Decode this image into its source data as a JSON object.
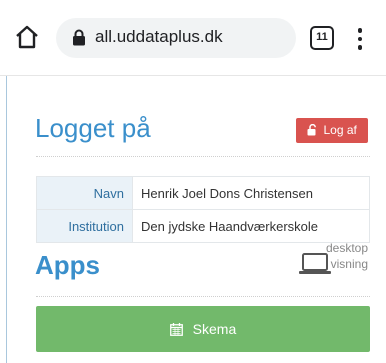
{
  "browser": {
    "url": "all.uddataplus.dk",
    "tab_count": "11"
  },
  "header": {
    "title": "Logget på",
    "logout_label": "Log af"
  },
  "info": {
    "rows": [
      {
        "label": "Navn",
        "value": "Henrik Joel Dons Christensen"
      },
      {
        "label": "Institution",
        "value": "Den jydske Haandværkerskole"
      }
    ]
  },
  "apps": {
    "title": "Apps",
    "desktop_line1": "desktop",
    "desktop_line2": "visning",
    "skema_label": "Skema"
  },
  "colors": {
    "heading": "#3a8fcb",
    "logout": "#d9534f",
    "skema": "#72b96b",
    "table_key_bg": "#eaf2f8"
  },
  "icons": [
    "home-icon",
    "lock-icon",
    "tabs-icon",
    "more-vert-icon",
    "unlock-icon",
    "laptop-icon",
    "calendar-icon"
  ]
}
